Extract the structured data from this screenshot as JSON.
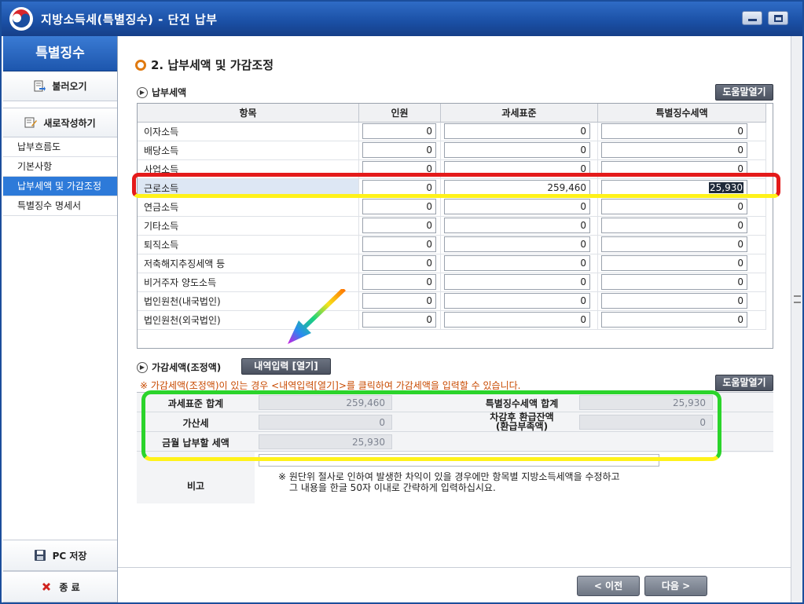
{
  "window": {
    "title": "지방소득세(특별징수) - 단건 납부"
  },
  "sidebar": {
    "header": "특별징수",
    "load_label": "불러오기",
    "new_label": "새로작성하기",
    "items": [
      {
        "label": "납부흐름도"
      },
      {
        "label": "기본사항"
      },
      {
        "label": "납부세액 및 가감조정"
      },
      {
        "label": "특별징수 명세서"
      }
    ],
    "save_label": "PC 저장",
    "exit_label": "종 료"
  },
  "main": {
    "step_title": "2. 납부세액 및 가감조정",
    "tax_section": {
      "title": "납부세액",
      "help_label": "도움말열기",
      "columns": [
        "항목",
        "인원",
        "과세표준",
        "특별징수세액"
      ],
      "rows": [
        {
          "label": "이자소득",
          "people": "0",
          "base": "0",
          "tax": "0"
        },
        {
          "label": "배당소득",
          "people": "0",
          "base": "0",
          "tax": "0"
        },
        {
          "label": "사업소득",
          "people": "0",
          "base": "0",
          "tax": "0"
        },
        {
          "label": "근로소득",
          "people": "0",
          "base": "259,460",
          "tax": "25,930"
        },
        {
          "label": "연금소득",
          "people": "0",
          "base": "0",
          "tax": "0"
        },
        {
          "label": "기타소득",
          "people": "0",
          "base": "0",
          "tax": "0"
        },
        {
          "label": "퇴직소득",
          "people": "0",
          "base": "0",
          "tax": "0"
        },
        {
          "label": "저축해지추징세액 등",
          "people": "0",
          "base": "0",
          "tax": "0"
        },
        {
          "label": "비거주자 양도소득",
          "people": "0",
          "base": "0",
          "tax": "0"
        },
        {
          "label": "법인원천(내국법인)",
          "people": "0",
          "base": "0",
          "tax": "0"
        },
        {
          "label": "법인원천(외국법인)",
          "people": "0",
          "base": "0",
          "tax": "0"
        }
      ]
    },
    "adjust_section": {
      "title": "가감세액(조정액)",
      "detail_button": "내역입력 [열기]",
      "note": "※ 가감세액(조정액)이 있는 경우 <내역입력[열기]>를 클릭하여 가감세액을 입력할 수 있습니다.",
      "help_label": "도움말열기",
      "base_total_label": "과세표준 합계",
      "base_total_value": "259,460",
      "tax_total_label": "특별징수세액 합계",
      "tax_total_value": "25,930",
      "penalty_label": "가산세",
      "penalty_value": "0",
      "refund_label": "차감후 환급잔액",
      "refund_sub": "(환급부족액)",
      "refund_value": "0",
      "pay_label": "금월 납부할 세액",
      "pay_value": "25,930",
      "remarks_label": "비고",
      "remarks_note_1": "※ 원단위 절사로 인하여 발생한 차익이 있을 경우에만 항목별 지방소득세액을 수정하고",
      "remarks_note_2": "그 내용을 한글 50자 이내로 간략하게 입력하십시요."
    },
    "prev_label": "< 이전",
    "next_label": "다음 >"
  },
  "colors": {
    "title_blue": "#1a4fa4",
    "active_item": "#2d7ad9",
    "note_orange": "#c84a00",
    "highlight_red": "#e41a1a",
    "highlight_green": "#2bd42b",
    "highlight_yellow": "#fff21a"
  }
}
